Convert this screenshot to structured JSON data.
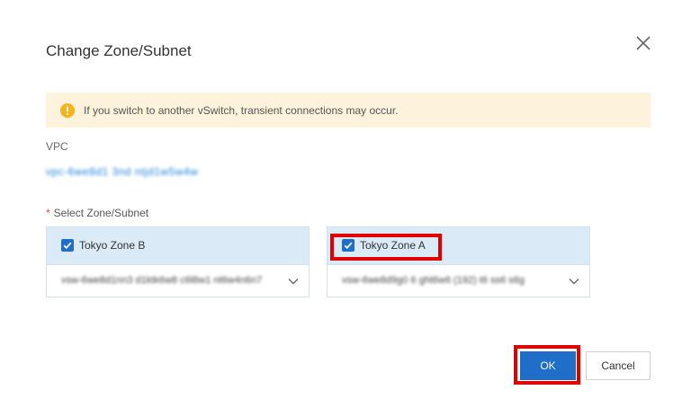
{
  "dialog": {
    "title": "Change Zone/Subnet",
    "close_icon": "close-icon"
  },
  "alert": {
    "icon": "warning-icon",
    "text": "If you switch to another vSwitch, transient connections may occur.",
    "color": "#fdf3dc"
  },
  "vpc": {
    "label": "VPC",
    "value": "vpc-6we8d1 3nd ntjd1w5w4w"
  },
  "zones": {
    "required_mark": "*",
    "label": "Select Zone/Subnet",
    "items": [
      {
        "name": "Tokyo Zone B",
        "checked": true,
        "subnet": "vsw-6we8d1nn3 d1ktk6w8 c6l8w1 nt6w4n6n7"
      },
      {
        "name": "Tokyo Zone A",
        "checked": true,
        "subnet": "vsw-6we8d9g0 6 ght6w6 (192) t6 ss6 s6g"
      }
    ]
  },
  "footer": {
    "ok_label": "OK",
    "cancel_label": "Cancel"
  },
  "colors": {
    "primary": "#1f6fc9",
    "highlight": "#e00000",
    "zone_header": "#dbeaf7"
  }
}
